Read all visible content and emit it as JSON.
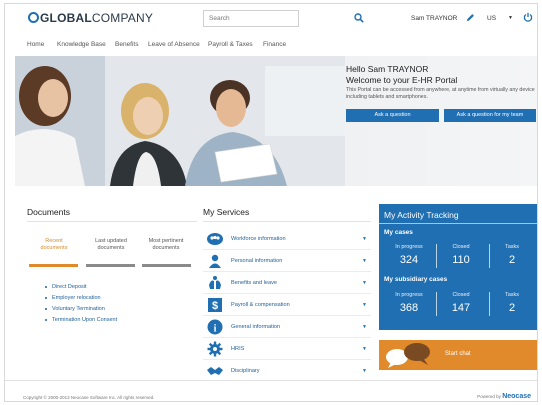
{
  "header": {
    "logo_prefix": "GLOBAL",
    "logo_suffix": "COMPANY",
    "search_placeholder": "Search",
    "user_name": "Sam TRAYNOR",
    "language": "US"
  },
  "nav": {
    "items": [
      "Home",
      "Knowledge Base",
      "Benefits",
      "Leave of Absence",
      "Payroll & Taxes",
      "Finance"
    ]
  },
  "hero": {
    "title": "Hello Sam TRAYNOR",
    "subtitle": "Welcome to your E-HR Portal",
    "text": "This Portal can be accessed from anywhere, at anytime from virtually any device including tablets and smartphones.",
    "ask_button": "Ask a question",
    "ask_team_button": "Ask a question for my team"
  },
  "documents": {
    "title": "Documents",
    "tabs": [
      {
        "line1": "Recent",
        "line2": "documents",
        "active": true
      },
      {
        "line1": "Last updated",
        "line2": "documents",
        "active": false
      },
      {
        "line1": "Most pertinent",
        "line2": "documents",
        "active": false
      }
    ],
    "list": [
      "Direct Deposit",
      "Employer relocation",
      "Voluntary Termination",
      "Termination Upon Consent"
    ]
  },
  "services": {
    "title": "My Services",
    "items": [
      {
        "label": "Workforce information",
        "icon": "team-icon"
      },
      {
        "label": "Personal information",
        "icon": "person-icon"
      },
      {
        "label": "Benefits and leave",
        "icon": "benefits-icon"
      },
      {
        "label": "Payroll & compensation",
        "icon": "dollar-icon"
      },
      {
        "label": "General information",
        "icon": "info-icon"
      },
      {
        "label": "HRIS",
        "icon": "gear-icon"
      },
      {
        "label": "Disciplinary",
        "icon": "handshake-icon"
      }
    ]
  },
  "activity": {
    "title": "My Activity Tracking",
    "cases_title": "My cases",
    "cases": [
      {
        "label": "In progress",
        "value": "324"
      },
      {
        "label": "Closed",
        "value": "110"
      },
      {
        "label": "Tasks",
        "value": "2"
      }
    ],
    "sub_title": "My subsidiary cases",
    "sub_cases": [
      {
        "label": "In progress",
        "value": "368"
      },
      {
        "label": "Closed",
        "value": "147"
      },
      {
        "label": "Tasks",
        "value": "2"
      }
    ]
  },
  "chat": {
    "label": "Start chat"
  },
  "footer": {
    "copyright": "Copyright © 2000-2013 Neocase Software Inc. All rights reserved.",
    "powered_by": "Powered by",
    "brand": "Neocase"
  },
  "colors": {
    "accent": "#1f6fb2",
    "orange": "#e08a2c"
  }
}
